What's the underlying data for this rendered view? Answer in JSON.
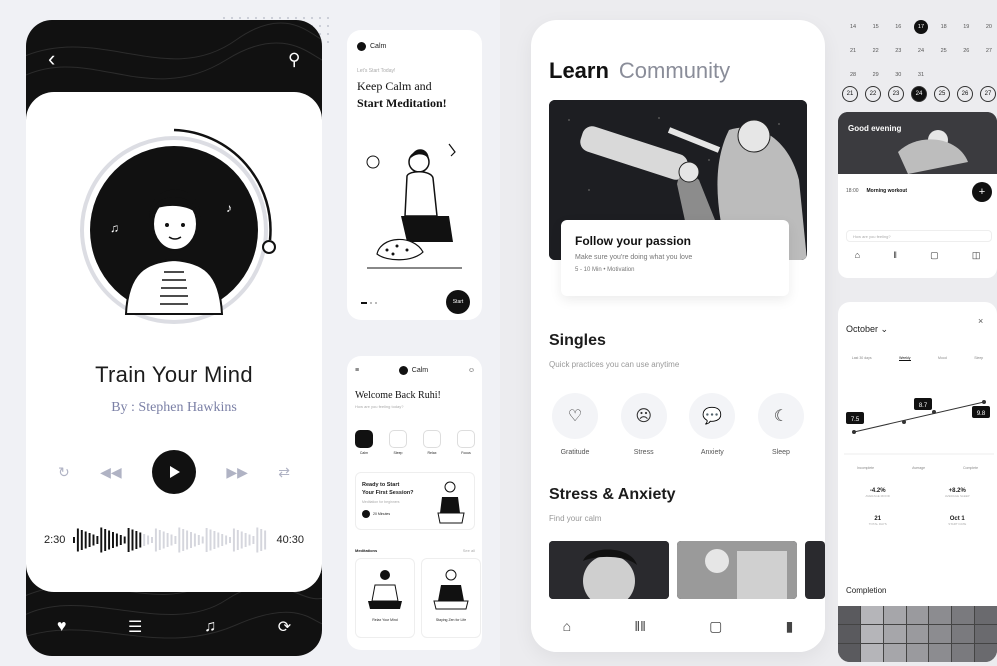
{
  "player": {
    "title": "Train Your Mind",
    "author": "By : Stephen Hawkins",
    "time_elapsed": "2:30",
    "time_total": "40:30",
    "icons": [
      "back-chevron-icon",
      "search-icon",
      "repeat-icon",
      "rewind-icon",
      "play-icon",
      "forward-icon",
      "shuffle-icon",
      "heart-icon",
      "playlist-icon",
      "music-note-icon",
      "share-icon"
    ]
  },
  "mini1": {
    "logo": "Calm",
    "greeting": "Let's Start Today!",
    "heading_line1": "Keep Calm and",
    "heading_line2": "Start Meditation!",
    "start_button": "Start"
  },
  "mini2": {
    "logo": "Calm",
    "heading": "Welcome Back Ruhi!",
    "sub": "How are you feeling today?",
    "categories": [
      "Calm",
      "Sleep",
      "Relax",
      "Focus"
    ],
    "card_title_line1": "Ready to Start",
    "card_title_line2": "Your First Session?",
    "card_sub": "Meditation for beginners",
    "card_duration": "20 Minutes",
    "meditations_label": "Meditations",
    "see_all": "See all",
    "med_items": [
      "Relax Your Mind",
      "Staying Zen for Life"
    ]
  },
  "learn": {
    "tab_active": "Learn",
    "tab_inactive": "Community",
    "hero_title": "Follow your passion",
    "hero_desc": "Make sure you're doing what you love",
    "hero_meta": "5 - 10 Min  •  Motivation",
    "singles_title": "Singles",
    "singles_sub": "Quick practices you can use anytime",
    "singles": [
      {
        "label": "Gratitude",
        "icon": "heart-outline-icon"
      },
      {
        "label": "Stress",
        "icon": "sad-face-icon"
      },
      {
        "label": "Anxiety",
        "icon": "speech-bubble-icon"
      },
      {
        "label": "Sleep",
        "icon": "moon-icon"
      }
    ],
    "stress_title": "Stress & Anxiety",
    "stress_sub": "Find your calm",
    "nav": [
      "home-icon",
      "stats-icon",
      "calendar-icon",
      "bookmark-icon"
    ]
  },
  "calendar": {
    "rows": [
      [
        "14",
        "15",
        "16",
        "17",
        "18",
        "19",
        "20"
      ],
      [
        "21",
        "22",
        "23",
        "24",
        "25",
        "26",
        "27"
      ],
      [
        "28",
        "29",
        "30",
        "31",
        "",
        "",
        ""
      ]
    ],
    "week": [
      "21",
      "22",
      "23",
      "24",
      "25",
      "26",
      "27"
    ],
    "highlight": "24"
  },
  "evening": {
    "greeting": "Good evening",
    "task_time": "18:00",
    "task": "Morning workout",
    "prompt": "How are you feeling?",
    "nav": [
      "home-icon",
      "stats-icon",
      "calendar-icon",
      "notes-icon"
    ]
  },
  "stats": {
    "month": "October",
    "filters": [
      "Last 30 days",
      "Weekly",
      "Mood",
      "Sleep"
    ],
    "point_labels": [
      "7.5",
      "8.7",
      "9.8"
    ],
    "labels_row": [
      "Incomplete",
      "Average",
      "Complete"
    ],
    "metrics": [
      {
        "value": "-4.2%",
        "label": "AVERAGE MOOD"
      },
      {
        "value": "+8.2%",
        "label": "AVERAGE SLEEP"
      },
      {
        "value": "21",
        "label": "TOTAL DAYS"
      },
      {
        "value": "Oct 1",
        "label": "START DATE"
      }
    ],
    "completion": "Completion"
  }
}
